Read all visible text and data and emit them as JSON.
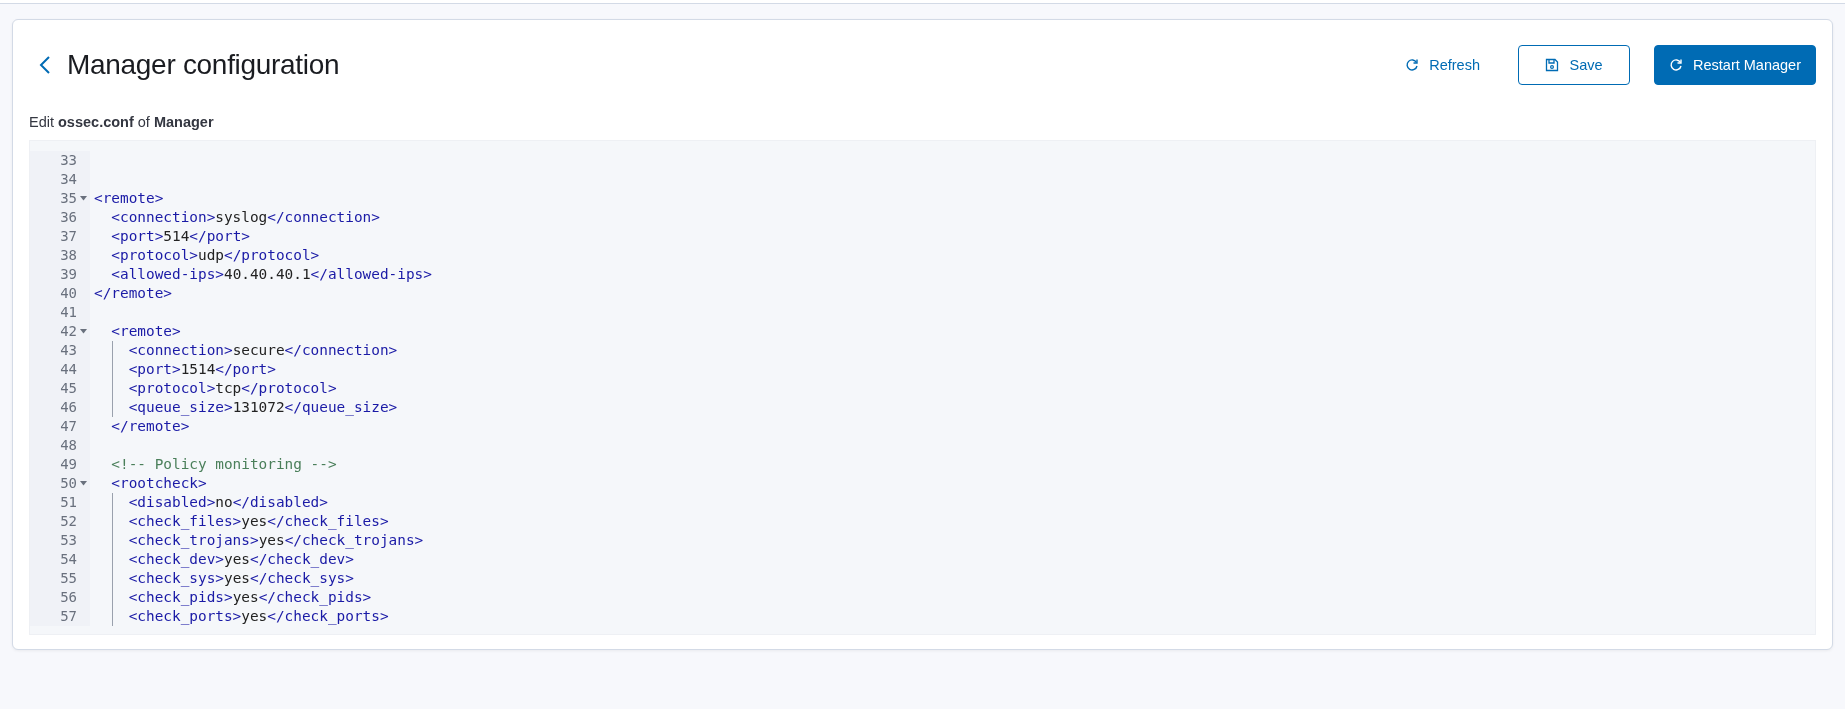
{
  "header": {
    "title": "Manager configuration",
    "subtitle": "Edit **ossec.conf** of **Manager**"
  },
  "buttons": [
    {
      "kind": "link",
      "label": "Refresh"
    },
    {
      "kind": "outline",
      "label": "Save"
    },
    {
      "kind": "primary",
      "label": "Restart Manager"
    }
  ],
  "editor": {
    "lines": [
      {
        "number": "33",
        "fold": false,
        "guide": false
      },
      {
        "number": "34",
        "fold": false,
        "guide": false
      },
      {
        "number": "35",
        "fold": true,
        "guide": false,
        "tokens": [
          {
            "kind": "tag",
            "text": "<remote>"
          }
        ]
      },
      {
        "number": "36",
        "fold": false,
        "guide": false,
        "tokens": [
          {
            "kind": "tag",
            "text": "  <connection>"
          },
          {
            "kind": "text",
            "text": "syslog"
          },
          {
            "kind": "tag",
            "text": "</connection>"
          }
        ]
      },
      {
        "number": "37",
        "fold": false,
        "guide": false,
        "tokens": [
          {
            "kind": "tag",
            "text": "  <port>"
          },
          {
            "kind": "text",
            "text": "514"
          },
          {
            "kind": "tag",
            "text": "</port>"
          }
        ]
      },
      {
        "number": "38",
        "fold": false,
        "guide": false,
        "tokens": [
          {
            "kind": "tag",
            "text": "  <protocol>"
          },
          {
            "kind": "text",
            "text": "udp"
          },
          {
            "kind": "tag",
            "text": "</protocol>"
          }
        ]
      },
      {
        "number": "39",
        "fold": false,
        "guide": false,
        "tokens": [
          {
            "kind": "tag",
            "text": "  <allowed-ips>"
          },
          {
            "kind": "text",
            "text": "40.40.40.1"
          },
          {
            "kind": "tag",
            "text": "</allowed-ips>"
          }
        ]
      },
      {
        "number": "40",
        "fold": false,
        "guide": false,
        "tokens": [
          {
            "kind": "tag",
            "text": "</remote>"
          }
        ]
      },
      {
        "number": "41",
        "fold": false,
        "guide": false
      },
      {
        "number": "42",
        "fold": true,
        "guide": false,
        "tokens": [
          {
            "kind": "tag",
            "text": "  <remote>"
          }
        ]
      },
      {
        "number": "43",
        "fold": false,
        "guide": true,
        "tokens": [
          {
            "kind": "tag",
            "text": "    <connection>"
          },
          {
            "kind": "text",
            "text": "secure"
          },
          {
            "kind": "tag",
            "text": "</connection>"
          }
        ]
      },
      {
        "number": "44",
        "fold": false,
        "guide": true,
        "tokens": [
          {
            "kind": "tag",
            "text": "    <port>"
          },
          {
            "kind": "text",
            "text": "1514"
          },
          {
            "kind": "tag",
            "text": "</port>"
          }
        ]
      },
      {
        "number": "45",
        "fold": false,
        "guide": true,
        "tokens": [
          {
            "kind": "tag",
            "text": "    <protocol>"
          },
          {
            "kind": "text",
            "text": "tcp"
          },
          {
            "kind": "tag",
            "text": "</protocol>"
          }
        ]
      },
      {
        "number": "46",
        "fold": false,
        "guide": true,
        "tokens": [
          {
            "kind": "tag",
            "text": "    <queue_size>"
          },
          {
            "kind": "text",
            "text": "131072"
          },
          {
            "kind": "tag",
            "text": "</queue_size>"
          }
        ]
      },
      {
        "number": "47",
        "fold": false,
        "guide": false,
        "tokens": [
          {
            "kind": "tag",
            "text": "  </remote>"
          }
        ]
      },
      {
        "number": "48",
        "fold": false,
        "guide": false
      },
      {
        "number": "49",
        "fold": false,
        "guide": false,
        "tokens": [
          {
            "kind": "comment",
            "text": "  <!-- Policy monitoring -->"
          }
        ]
      },
      {
        "number": "50",
        "fold": true,
        "guide": false,
        "tokens": [
          {
            "kind": "tag",
            "text": "  <rootcheck>"
          }
        ]
      },
      {
        "number": "51",
        "fold": false,
        "guide": true,
        "tokens": [
          {
            "kind": "tag",
            "text": "    <disabled>"
          },
          {
            "kind": "text",
            "text": "no"
          },
          {
            "kind": "tag",
            "text": "</disabled>"
          }
        ]
      },
      {
        "number": "52",
        "fold": false,
        "guide": true,
        "tokens": [
          {
            "kind": "tag",
            "text": "    <check_files>"
          },
          {
            "kind": "text",
            "text": "yes"
          },
          {
            "kind": "tag",
            "text": "</check_files>"
          }
        ]
      },
      {
        "number": "53",
        "fold": false,
        "guide": true,
        "tokens": [
          {
            "kind": "tag",
            "text": "    <check_trojans>"
          },
          {
            "kind": "text",
            "text": "yes"
          },
          {
            "kind": "tag",
            "text": "</check_trojans>"
          }
        ]
      },
      {
        "number": "54",
        "fold": false,
        "guide": true,
        "tokens": [
          {
            "kind": "tag",
            "text": "    <check_dev>"
          },
          {
            "kind": "text",
            "text": "yes"
          },
          {
            "kind": "tag",
            "text": "</check_dev>"
          }
        ]
      },
      {
        "number": "55",
        "fold": false,
        "guide": true,
        "tokens": [
          {
            "kind": "tag",
            "text": "    <check_sys>"
          },
          {
            "kind": "text",
            "text": "yes"
          },
          {
            "kind": "tag",
            "text": "</check_sys>"
          }
        ]
      },
      {
        "number": "56",
        "fold": false,
        "guide": true,
        "tokens": [
          {
            "kind": "tag",
            "text": "    <check_pids>"
          },
          {
            "kind": "text",
            "text": "yes"
          },
          {
            "kind": "tag",
            "text": "</check_pids>"
          }
        ]
      },
      {
        "number": "57",
        "fold": false,
        "guide": true,
        "tokens": [
          {
            "kind": "tag",
            "text": "    <check_ports>"
          },
          {
            "kind": "text",
            "text": "yes"
          },
          {
            "kind": "tag",
            "text": "</check_ports>"
          }
        ]
      }
    ]
  }
}
